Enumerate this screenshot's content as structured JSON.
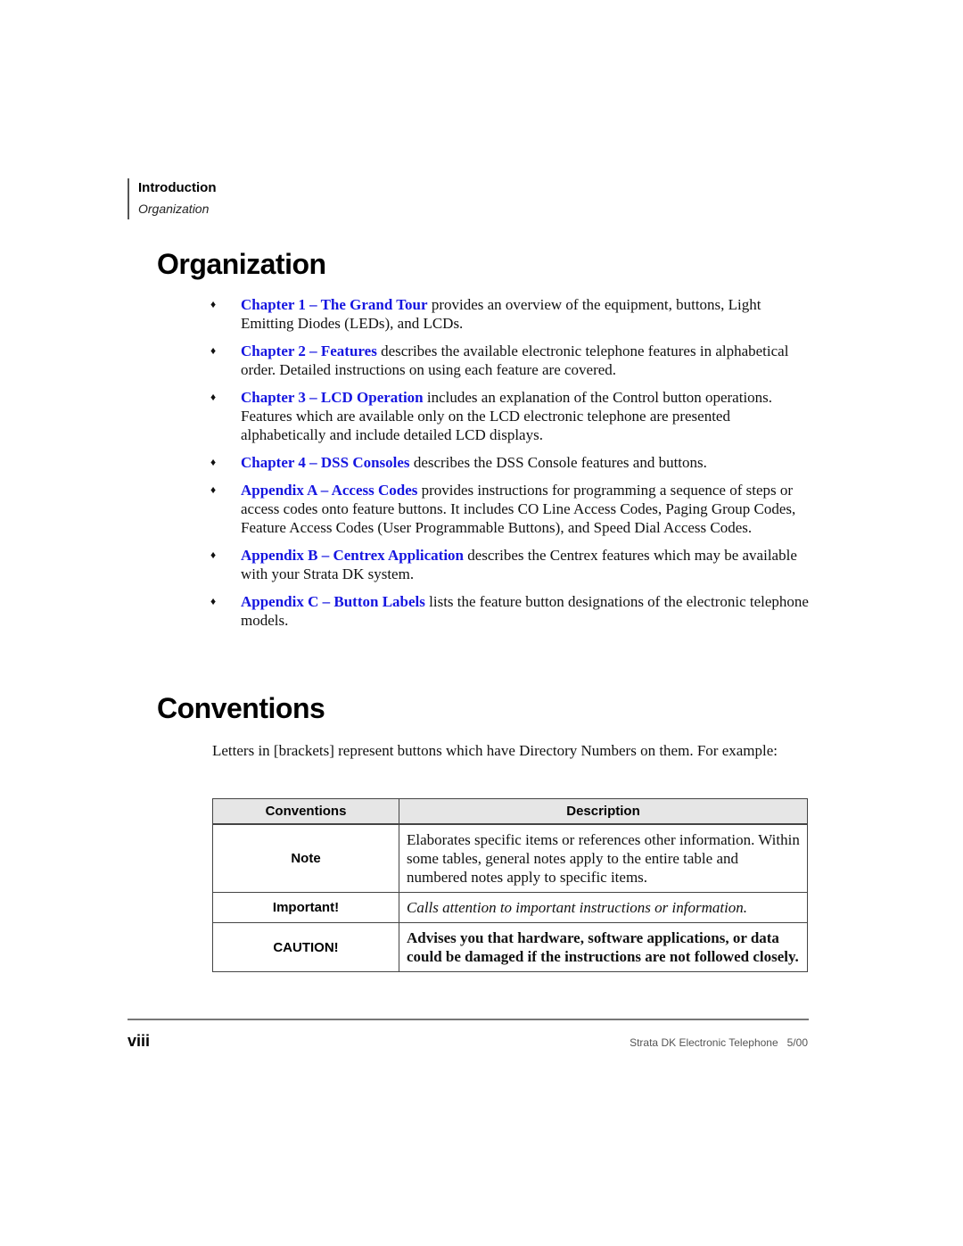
{
  "running_header": {
    "chapter": "Introduction",
    "section": "Organization"
  },
  "organization": {
    "heading": "Organization",
    "bullet_glyph": "♦",
    "items": [
      {
        "link": "Chapter 1 – The Grand Tour",
        "text": " provides an overview of the equipment, buttons, Light Emitting Diodes (LEDs), and LCDs."
      },
      {
        "link": "Chapter 2 – Features",
        "text": " describes the available electronic telephone features in alphabetical order. Detailed instructions on using each feature are covered."
      },
      {
        "link": "Chapter 3 – LCD Operation",
        "text": " includes an explanation of the Control button operations. Features which are available only on the LCD electronic telephone are presented alphabetically and include detailed LCD displays."
      },
      {
        "link": "Chapter 4 – DSS Consoles",
        "text": " describes the DSS Console features and buttons."
      },
      {
        "link": "Appendix A – Access Codes",
        "text": " provides instructions for programming a sequence of steps or access codes onto feature buttons. It includes CO Line Access Codes, Paging Group Codes, Feature Access Codes (User Programmable Buttons), and Speed Dial Access Codes."
      },
      {
        "link": "Appendix B – Centrex Application",
        "text": " describes the Centrex features which may be available with your Strata DK system."
      },
      {
        "link": "Appendix C – Button Labels",
        "text": " lists the feature button designations of the electronic telephone models."
      }
    ]
  },
  "conventions": {
    "heading": "Conventions",
    "intro": "Letters in [brackets] represent buttons which have Directory Numbers on them. For example:",
    "table": {
      "headers": [
        "Conventions",
        "Description"
      ],
      "rows": [
        {
          "convention": "Note",
          "description": "Elaborates specific items or references other information. Within some tables, general notes apply to the entire table and numbered notes apply to specific items."
        },
        {
          "convention": "Important!",
          "description": "Calls attention to important instructions or information."
        },
        {
          "convention": "CAUTION!",
          "description": "Advises you that hardware, software applications, or data could be damaged if the instructions are not followed closely."
        }
      ]
    }
  },
  "footer": {
    "page_number": "viii",
    "title": "Strata DK Electronic Telephone   5/00"
  },
  "colors": {
    "link": "#1515e0",
    "table_header_bg": "#e6e6e6"
  }
}
